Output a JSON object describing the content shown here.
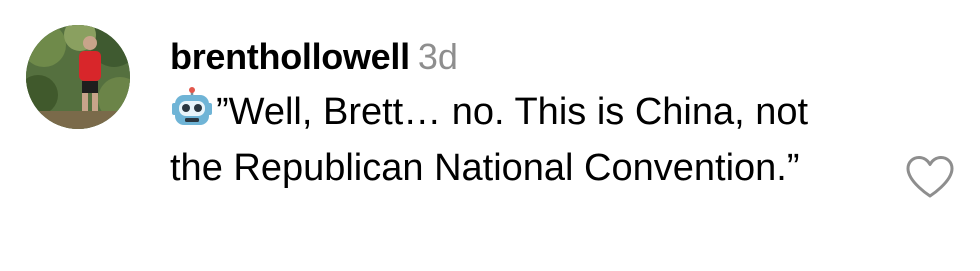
{
  "comment": {
    "username": "brenthollowell",
    "time": "3d",
    "emoji_icon": "robot-face-icon",
    "text": "”Well, Brett… no. This is China, not the Republican National Convention.”",
    "like_icon": "heart-outline-icon"
  },
  "colors": {
    "background": "#ffffff",
    "text": "#000000",
    "muted": "#8e8e8e",
    "robot": "#6fb4d6"
  }
}
